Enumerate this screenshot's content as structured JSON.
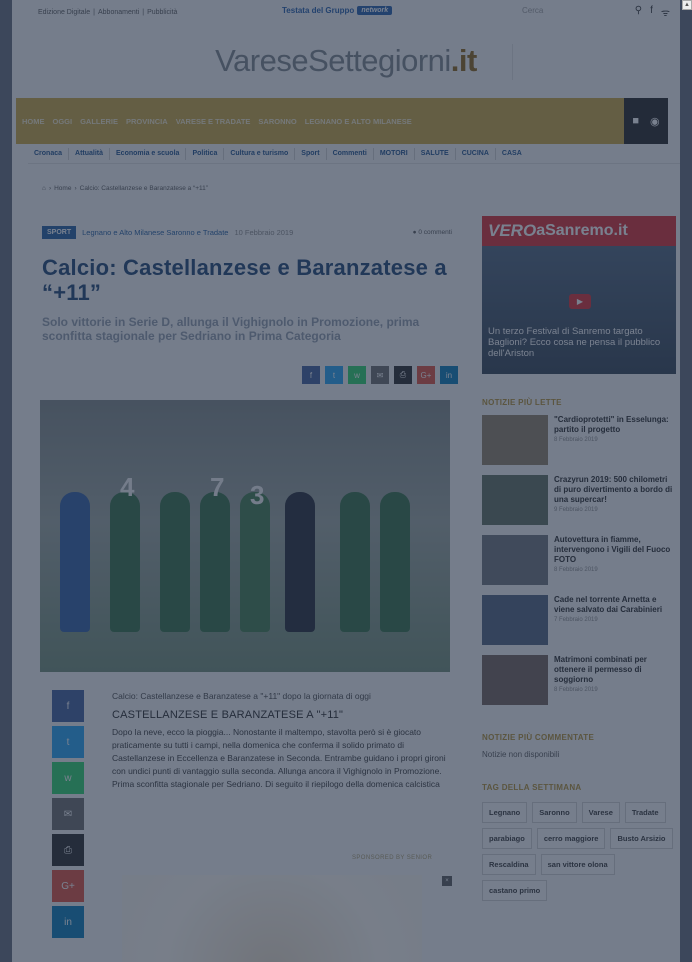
{
  "topbar": {
    "links": [
      "Edizione Digitale",
      "|",
      "Abbonamenti",
      "|",
      "Pubblicità"
    ],
    "group_label": "Testata del Gruppo",
    "network_badge": "network",
    "search_placeholder": "Cerca"
  },
  "logo": {
    "name": "VareseSettegiorni",
    "tld": ".it"
  },
  "nav": {
    "items": [
      "HOME",
      "OGGI",
      "GALLERIE",
      "PROVINCIA",
      "VARESE E TRADATE",
      "SARONNO",
      "LEGNANO E ALTO MILANESE"
    ],
    "video_icon": "video-camera-icon",
    "photo_icon": "camera-icon"
  },
  "subnav": [
    "Cronaca",
    "Attualità",
    "Economia e scuola",
    "Politica",
    "Cultura e turismo",
    "Sport",
    "Commenti",
    "MOTORI",
    "SALUTE",
    "CUCINA",
    "CASA"
  ],
  "breadcrumb": {
    "home_icon": "home-icon",
    "items": [
      "Home",
      "Calcio: Castellanzese e Baranzatese a “+11”"
    ]
  },
  "article": {
    "tag": "SPORT",
    "locations": "Legnano e Alto Milanese Saronno e Tradate",
    "date": "10 Febbraio 2019",
    "comments": "0 commenti",
    "title": "Calcio: Castellanzese e Baranzatese a “+11”",
    "subtitle": "Solo vittorie in Serie D, allunga il Vighignolo in Promozione, prima sconfitta stagionale per Sedriano in Prima Categoria",
    "lead": "Calcio: Castellanzese e Baranzatese a \"+11\" dopo la giornata di oggi",
    "section_heading": "CASTELLANZESE E BARANZATESE A \"+11\"",
    "body": "Dopo la neve, ecco la pioggia... Nonostante il maltempo, stavolta però si è giocato praticamente su tutti i campi, nella domenica che conferma il solido primato di Castellanzese in Eccellenza e Baranzatese in Seconda. Entrambe guidano i propri gironi con undici punti di vantaggio sulla seconda. Allunga ancora il Vighignolo in Promozione. Prima sconfitta stagionale per Sedriano. Di seguito il riepilogo della domenica calcistica",
    "sponsored": "SPONSORED BY SENIOR",
    "ad_close": "×"
  },
  "share": {
    "top": [
      {
        "icon": "facebook-icon",
        "glyph": "f",
        "color": "#3b5998"
      },
      {
        "icon": "twitter-icon",
        "glyph": "t",
        "color": "#1da1f2"
      },
      {
        "icon": "whatsapp-icon",
        "glyph": "w",
        "color": "#25d366"
      },
      {
        "icon": "email-icon",
        "glyph": "✉",
        "color": "#666666"
      },
      {
        "icon": "print-icon",
        "glyph": "⎙",
        "color": "#222222"
      },
      {
        "icon": "googleplus-icon",
        "glyph": "G+",
        "color": "#dd4b39"
      },
      {
        "icon": "linkedin-icon",
        "glyph": "in",
        "color": "#0077b5"
      }
    ]
  },
  "sidebar": {
    "promo": {
      "brand": "VERO",
      "brand_rest": "aSanremo.it",
      "caption": "Un terzo Festival di Sanremo targato Baglioni? Ecco cosa ne pensa il pubblico dell'Ariston"
    },
    "latest_title": "NOTIZIE PIÙ LETTE",
    "latest": [
      {
        "title": "\"Cardioprotetti\" in Esselunga: partito il progetto",
        "date": "8 Febbraio 2019",
        "color": "#8c7b63"
      },
      {
        "title": "Crazyrun 2019: 500 chilometri di puro divertimento a bordo di una supercar!",
        "date": "9 Febbraio 2019",
        "color": "#596b5a"
      },
      {
        "title": "Autovettura in fiamme, intervengono i Vigili del Fuoco FOTO",
        "date": "8 Febbraio 2019",
        "color": "#6b6f78"
      },
      {
        "title": "Cade nel torrente Arnetta e viene salvato dai Carabinieri",
        "date": "7 Febbraio 2019",
        "color": "#4b5c7a"
      },
      {
        "title": "Matrimoni combinati per ottenere il permesso di soggiorno",
        "date": "8 Febbraio 2019",
        "color": "#6e5e55"
      }
    ],
    "commented_title": "NOTIZIE PIÙ COMMENTATE",
    "commented_empty": "Notizie non disponibili",
    "tags_title": "TAG DELLA SETTIMANA",
    "tags": [
      "Legnano",
      "Saronno",
      "Varese",
      "Tradate",
      "parabiago",
      "cerro maggiore",
      "Busto Arsizio",
      "Rescaldina",
      "san vittore olona",
      "castano primo"
    ]
  }
}
